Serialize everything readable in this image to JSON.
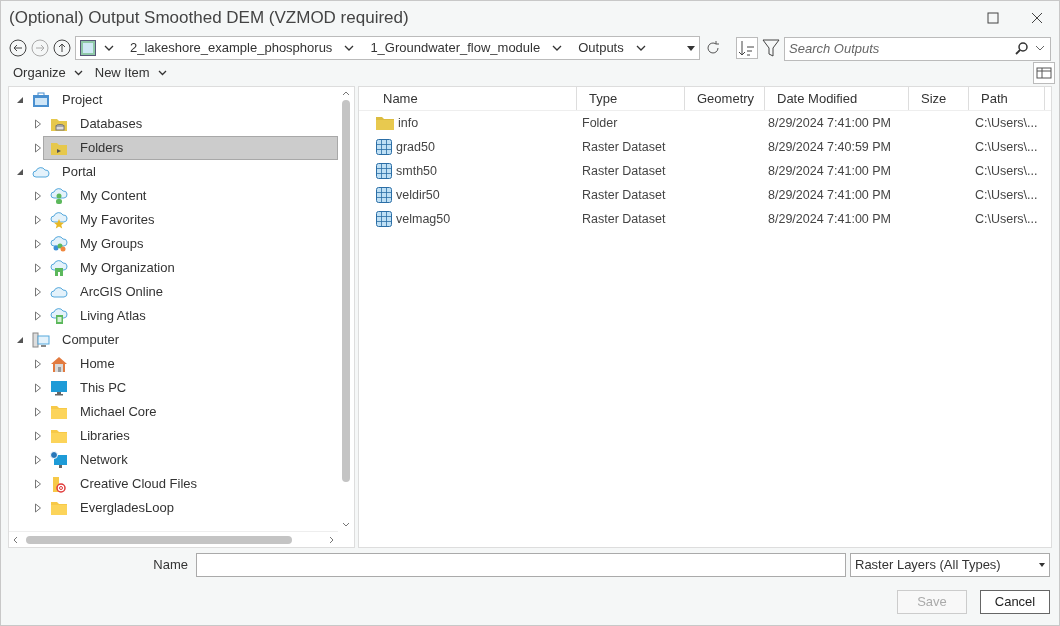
{
  "window": {
    "title": "(Optional) Output Smoothed DEM (VZMOD required)"
  },
  "breadcrumb": [
    "2_lakeshore_example_phosphorus",
    "1_Groundwater_flow_module",
    "Outputs"
  ],
  "search": {
    "placeholder": "Search Outputs"
  },
  "menu": [
    "Organize",
    "New Item"
  ],
  "tree": [
    {
      "label": "Project",
      "kind": "project",
      "expanded": true,
      "selected": false,
      "children": [
        {
          "label": "Databases",
          "kind": "database",
          "expanded": false,
          "selected": false
        },
        {
          "label": "Folders",
          "kind": "folder-open",
          "expanded": false,
          "selected": true
        }
      ]
    },
    {
      "label": "Portal",
      "kind": "cloud",
      "expanded": true,
      "selected": false,
      "children": [
        {
          "label": "My Content",
          "kind": "cloud-user",
          "expanded": false,
          "selected": false
        },
        {
          "label": "My Favorites",
          "kind": "cloud-star",
          "expanded": false,
          "selected": false
        },
        {
          "label": "My Groups",
          "kind": "cloud-group",
          "expanded": false,
          "selected": false
        },
        {
          "label": "My Organization",
          "kind": "cloud-building",
          "expanded": false,
          "selected": false
        },
        {
          "label": "ArcGIS Online",
          "kind": "cloud",
          "expanded": false,
          "selected": false
        },
        {
          "label": "Living Atlas",
          "kind": "cloud-book",
          "expanded": false,
          "selected": false
        }
      ]
    },
    {
      "label": "Computer",
      "kind": "computer",
      "expanded": true,
      "selected": false,
      "children": [
        {
          "label": "Home",
          "kind": "home",
          "expanded": false,
          "selected": false
        },
        {
          "label": "This PC",
          "kind": "monitor",
          "expanded": false,
          "selected": false
        },
        {
          "label": "Michael Core",
          "kind": "folder",
          "expanded": false,
          "selected": false
        },
        {
          "label": "Libraries",
          "kind": "folder",
          "expanded": false,
          "selected": false
        },
        {
          "label": "Network",
          "kind": "network",
          "expanded": false,
          "selected": false
        },
        {
          "label": "Creative Cloud Files",
          "kind": "creative",
          "expanded": false,
          "selected": false
        },
        {
          "label": "EvergladesLoop",
          "kind": "folder",
          "expanded": false,
          "selected": false
        }
      ]
    }
  ],
  "table": {
    "columns": [
      "Name",
      "Type",
      "Geometry",
      "Date Modified",
      "Size",
      "Path"
    ],
    "rows": [
      {
        "kind": "folder",
        "name": "info",
        "type": "Folder",
        "date": "8/29/2024 7:41:00 PM",
        "path": "C:\\Users\\..."
      },
      {
        "kind": "raster",
        "name": "grad50",
        "type": "Raster Dataset",
        "date": "8/29/2024 7:40:59 PM",
        "path": "C:\\Users\\..."
      },
      {
        "kind": "raster",
        "name": "smth50",
        "type": "Raster Dataset",
        "date": "8/29/2024 7:41:00 PM",
        "path": "C:\\Users\\..."
      },
      {
        "kind": "raster",
        "name": "veldir50",
        "type": "Raster Dataset",
        "date": "8/29/2024 7:41:00 PM",
        "path": "C:\\Users\\..."
      },
      {
        "kind": "raster",
        "name": "velmag50",
        "type": "Raster Dataset",
        "date": "8/29/2024 7:41:00 PM",
        "path": "C:\\Users\\..."
      }
    ]
  },
  "name_field": {
    "label": "Name"
  },
  "filter": {
    "value": "Raster Layers (All Types)"
  },
  "buttons": [
    {
      "label": "Save",
      "disabled": true
    },
    {
      "label": "Cancel",
      "disabled": false
    }
  ]
}
